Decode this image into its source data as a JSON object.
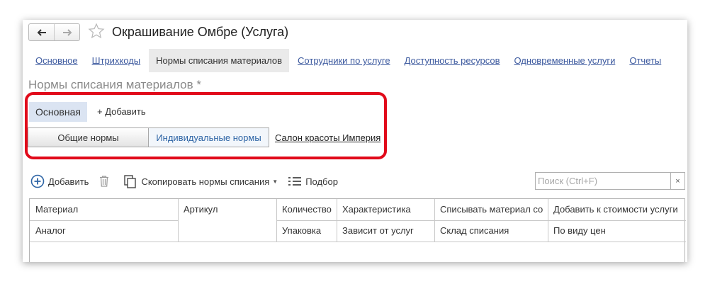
{
  "header": {
    "title": "Окрашивание Омбре (Услуга)",
    "back_icon": "arrow-left-icon",
    "forward_icon": "arrow-right-icon",
    "favorite_icon": "star-icon"
  },
  "tabs": [
    {
      "label": "Основное",
      "active": false
    },
    {
      "label": "Штрихкоды",
      "active": false
    },
    {
      "label": "Нормы списания материалов",
      "active": true
    },
    {
      "label": "Сотрудники по услуге",
      "active": false
    },
    {
      "label": "Доступность ресурсов",
      "active": false
    },
    {
      "label": "Одновременные услуги",
      "active": false
    },
    {
      "label": "Отчеты",
      "active": false
    }
  ],
  "section": {
    "title": "Нормы списания материалов *",
    "subtab": "Основная",
    "add_link": "+ Добавить",
    "toggle": {
      "left": "Общие нормы",
      "right": "Индивидуальные нормы",
      "selected": "right"
    },
    "salon": "Салон красоты Империя",
    "highlight_color": "#e10a1a"
  },
  "toolbar": {
    "add": "Добавить",
    "copy": "Скопировать нормы списания",
    "select": "Подбор",
    "search_placeholder": "Поиск (Ctrl+F)",
    "clear": "×"
  },
  "table": {
    "row1": [
      "Материал",
      "Артикул",
      "Количество",
      "Характеристика",
      "Списывать материал со",
      "Добавить к стоимости услуги"
    ],
    "row2": [
      "Аналог",
      "",
      "Упаковка",
      "Зависит от услуг",
      "Склад списания",
      "По виду цен"
    ]
  },
  "colors": {
    "link": "#3d5a9f",
    "accent": "#2d64a5",
    "active_tab_bg": "#eaeaea"
  }
}
